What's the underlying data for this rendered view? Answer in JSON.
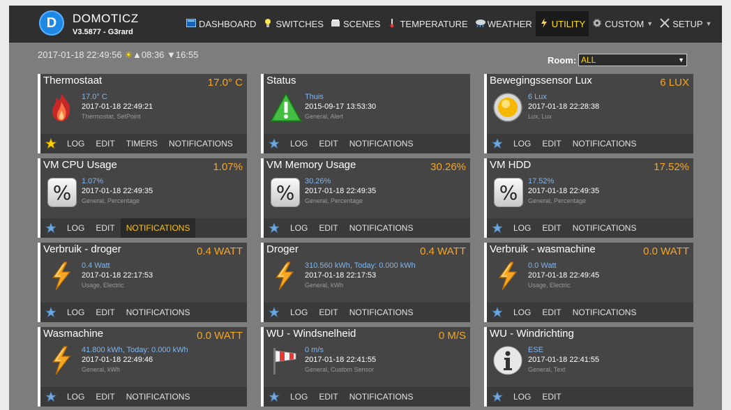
{
  "header": {
    "brand": "DOMOTICZ",
    "version": "V3.5877 - G3rard",
    "nav": [
      {
        "label": "DASHBOARD",
        "icon": "dashboard-icon"
      },
      {
        "label": "SWITCHES",
        "icon": "lightbulb-icon"
      },
      {
        "label": "SCENES",
        "icon": "scenes-icon"
      },
      {
        "label": "TEMPERATURE",
        "icon": "thermometer-icon"
      },
      {
        "label": "WEATHER",
        "icon": "weather-icon"
      },
      {
        "label": "UTILITY",
        "icon": "utility-icon"
      },
      {
        "label": "CUSTOM",
        "icon": "gear-icon"
      },
      {
        "label": "SETUP",
        "icon": "tools-icon"
      }
    ],
    "active_tab": "UTILITY"
  },
  "status": {
    "datetime": "2017-01-18 22:49:56",
    "sunrise": "08:36",
    "sunset": "16:55"
  },
  "room": {
    "label": "Room:",
    "value": "ALL"
  },
  "colors": {
    "accent": "#f5a623",
    "active_nav": "#ffe400",
    "link": "#7fb7f0"
  },
  "devices": [
    {
      "name": "Thermostaat",
      "value": "17.0° C",
      "line1": "17.0° C",
      "line2": "2017-01-18 22:49:21",
      "line3": "Thermostat, SetPoint",
      "icon": "flame-icon",
      "favorite": true,
      "buttons": [
        "LOG",
        "EDIT",
        "TIMERS",
        "NOTIFICATIONS"
      ]
    },
    {
      "name": "Status",
      "value": "",
      "line1": "Thuis",
      "line2": "2015-09-17 13:53:30",
      "line3": "General, Alert",
      "icon": "alert-icon",
      "favorite": false,
      "buttons": [
        "LOG",
        "EDIT",
        "NOTIFICATIONS"
      ]
    },
    {
      "name": "Bewegingssensor Lux",
      "value": "6 LUX",
      "line1": "6 Lux",
      "line2": "2017-01-18 22:28:38",
      "line3": "Lux, Lux",
      "icon": "lux-icon",
      "favorite": false,
      "buttons": [
        "LOG",
        "EDIT",
        "NOTIFICATIONS"
      ]
    },
    {
      "name": "VM CPU Usage",
      "value": "1.07%",
      "line1": "1.07%",
      "line2": "2017-01-18 22:49:35",
      "line3": "General, Percentage",
      "icon": "percent-icon",
      "favorite": false,
      "buttons": [
        "LOG",
        "EDIT",
        "NOTIFICATIONS"
      ],
      "active_button": "NOTIFICATIONS"
    },
    {
      "name": "VM Memory Usage",
      "value": "30.26%",
      "line1": "30.26%",
      "line2": "2017-01-18 22:49:35",
      "line3": "General, Percentage",
      "icon": "percent-icon",
      "favorite": false,
      "buttons": [
        "LOG",
        "EDIT",
        "NOTIFICATIONS"
      ]
    },
    {
      "name": "VM HDD",
      "value": "17.52%",
      "line1": "17.52%",
      "line2": "2017-01-18 22:49:35",
      "line3": "General, Percentage",
      "icon": "percent-icon",
      "favorite": false,
      "buttons": [
        "LOG",
        "EDIT",
        "NOTIFICATIONS"
      ]
    },
    {
      "name": "Verbruik - droger",
      "value": "0.4 WATT",
      "line1": "0.4 Watt",
      "line2": "2017-01-18 22:17:53",
      "line3": "Usage, Electric",
      "icon": "lightning-icon",
      "favorite": false,
      "buttons": [
        "LOG",
        "EDIT",
        "NOTIFICATIONS"
      ]
    },
    {
      "name": "Droger",
      "value": "0.4 WATT",
      "line1": "310.560 kWh, Today: 0.000 kWh",
      "line2": "2017-01-18 22:17:53",
      "line3": "General, kWh",
      "icon": "lightning-icon",
      "favorite": false,
      "buttons": [
        "LOG",
        "EDIT",
        "NOTIFICATIONS"
      ]
    },
    {
      "name": "Verbruik - wasmachine",
      "value": "0.0 WATT",
      "line1": "0.0 Watt",
      "line2": "2017-01-18 22:49:45",
      "line3": "Usage, Electric",
      "icon": "lightning-icon",
      "favorite": false,
      "buttons": [
        "LOG",
        "EDIT",
        "NOTIFICATIONS"
      ]
    },
    {
      "name": "Wasmachine",
      "value": "0.0 WATT",
      "line1": "41.800 kWh, Today: 0.000 kWh",
      "line2": "2017-01-18 22:49:46",
      "line3": "General, kWh",
      "icon": "lightning-icon",
      "favorite": false,
      "buttons": [
        "LOG",
        "EDIT",
        "NOTIFICATIONS"
      ]
    },
    {
      "name": "WU - Windsnelheid",
      "value": "0 M/S",
      "line1": "0 m/s",
      "line2": "2017-01-18 22:41:55",
      "line3": "General, Custom Sensor",
      "icon": "windsock-icon",
      "favorite": false,
      "buttons": [
        "LOG",
        "EDIT",
        "NOTIFICATIONS"
      ]
    },
    {
      "name": "WU - Windrichting",
      "value": "",
      "line1": "ESE",
      "line2": "2017-01-18 22:41:55",
      "line3": "General, Text",
      "icon": "info-icon",
      "favorite": false,
      "buttons": [
        "LOG",
        "EDIT"
      ]
    }
  ]
}
